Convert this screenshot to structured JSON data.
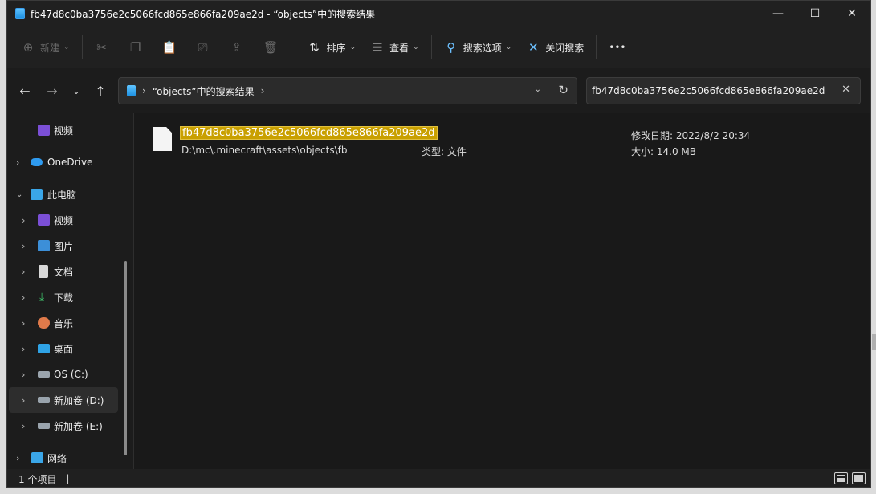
{
  "window": {
    "title": "fb47d8c0ba3756e2c5066fcd865e866fa209ae2d - “objects”中的搜索结果",
    "minimize": "—",
    "maximize": "☐",
    "close": "✕"
  },
  "toolbar": {
    "new_label": "新建",
    "sort_label": "排序",
    "view_label": "查看",
    "search_options_label": "搜索选项",
    "close_search_label": "关闭搜索",
    "more_label": "•••"
  },
  "address": {
    "breadcrumb": "“objects”中的搜索结果",
    "search_value": "fb47d8c0ba3756e2c5066fcd865e866fa209ae2d"
  },
  "sidebar": {
    "items": [
      {
        "label": "视频"
      },
      {
        "label": "OneDrive"
      },
      {
        "label": "此电脑"
      },
      {
        "label": "视频"
      },
      {
        "label": "图片"
      },
      {
        "label": "文档"
      },
      {
        "label": "下载"
      },
      {
        "label": "音乐"
      },
      {
        "label": "桌面"
      },
      {
        "label": "OS (C:)"
      },
      {
        "label": "新加卷 (D:)"
      },
      {
        "label": "新加卷 (E:)"
      },
      {
        "label": "网络"
      }
    ]
  },
  "results": [
    {
      "name": "fb47d8c0ba3756e2c5066fcd865e866fa209ae2d",
      "path": "D:\\mc\\.minecraft\\assets\\objects\\fb",
      "type": "类型: 文件",
      "modified": "修改日期: 2022/8/2 20:34",
      "size": "大小: 14.0 MB"
    }
  ],
  "status": {
    "count": "1 个项目",
    "mark": "|"
  },
  "colors": {
    "highlight": "#c9a000",
    "background": "#1c1c1c",
    "accent": "#1b8fe0"
  }
}
